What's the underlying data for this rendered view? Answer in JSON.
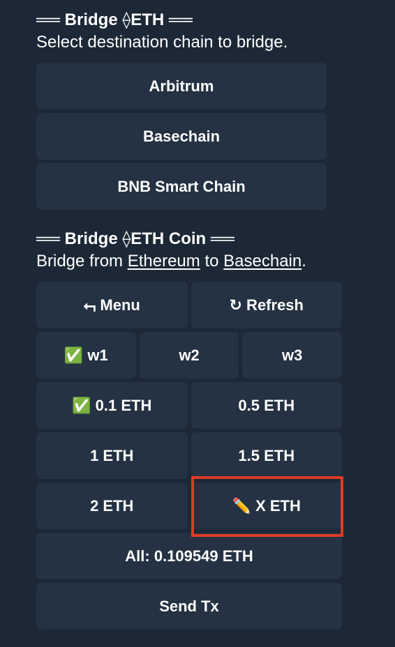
{
  "message1": {
    "heading": "══ Bridge ⟠ETH ══",
    "subtitle": "Select destination chain to bridge.",
    "buttons": [
      "Arbitrum",
      "Basechain",
      "BNB Smart Chain"
    ]
  },
  "message2": {
    "heading": "══ Bridge ⟠ETH Coin ══",
    "subtitle_prefix": "Bridge from ",
    "from_chain": "Ethereum",
    "subtitle_middle": " to ",
    "to_chain": "Basechain",
    "subtitle_suffix": ".",
    "menu_label": "⮢ Menu",
    "refresh_label": "↻ Refresh",
    "wallets": [
      "✅ w1",
      "w2",
      "w3"
    ],
    "amounts": [
      "✅ 0.1 ETH",
      "0.5 ETH",
      "1 ETH",
      "1.5 ETH",
      "2 ETH",
      "✏️ X ETH"
    ],
    "all_label": "All: 0.109549 ETH",
    "send_label": "Send Tx"
  },
  "colors": {
    "background": "#1c2836",
    "button": "#243243",
    "highlight": "#e03b24"
  }
}
